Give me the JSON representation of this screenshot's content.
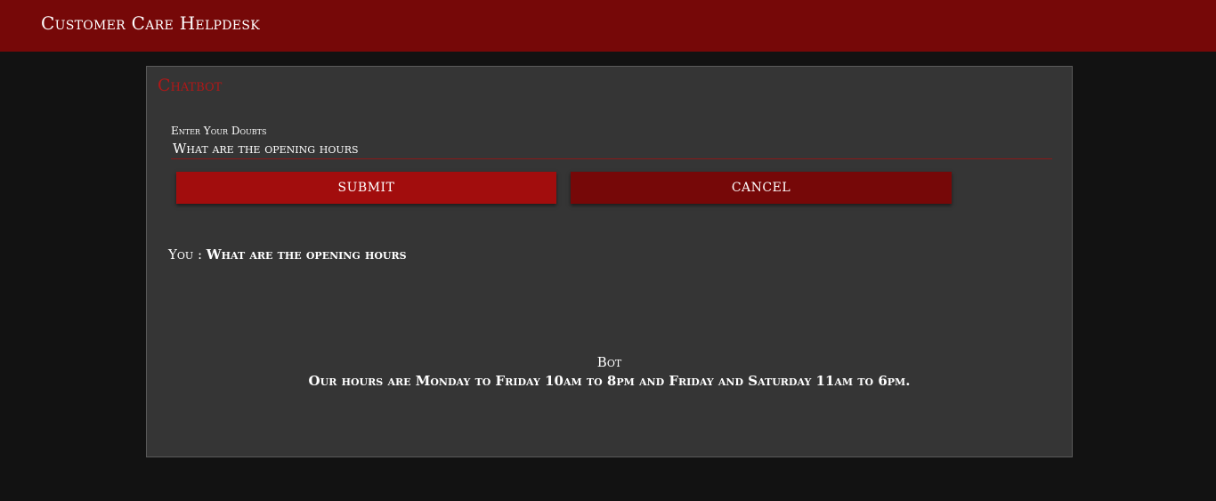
{
  "header": {
    "title": "Customer Care Helpdesk"
  },
  "panel": {
    "title": "Chatbot",
    "input": {
      "label": "Enter Your Doubts",
      "value": "What are the opening hours",
      "placeholder": ""
    },
    "buttons": {
      "submit_label": "SUBMIT",
      "cancel_label": "CANCEL"
    },
    "conversation": {
      "user_prefix": "You :",
      "user_message": "What are the opening hours",
      "bot_name": "Bot",
      "bot_message": "Our hours are Monday to Friday 10am to 8pm and Friday and Saturday 11am to 6pm."
    }
  },
  "colors": {
    "header_bg": "#760808",
    "page_bg": "#121212",
    "panel_bg": "#353535",
    "accent": "#b01818",
    "submit_bg": "#a20d0d",
    "cancel_bg": "#760808"
  }
}
